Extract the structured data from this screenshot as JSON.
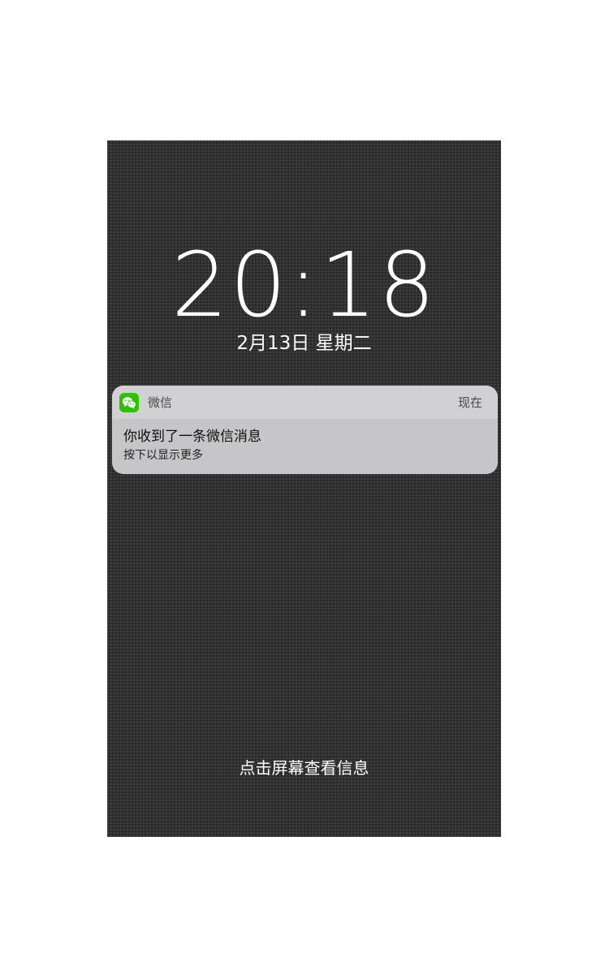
{
  "lockscreen": {
    "time": "20:18",
    "date": "2月13日 星期二",
    "hint": "点击屏幕查看信息"
  },
  "notification": {
    "app_name": "微信",
    "app_icon": "wechat-icon",
    "time_label": "现在",
    "title": "你收到了一条微信消息",
    "body": "按下以显示更多"
  },
  "colors": {
    "wechat_green": "#2dc100",
    "background": "#333333",
    "card": "#c6c5c7"
  }
}
